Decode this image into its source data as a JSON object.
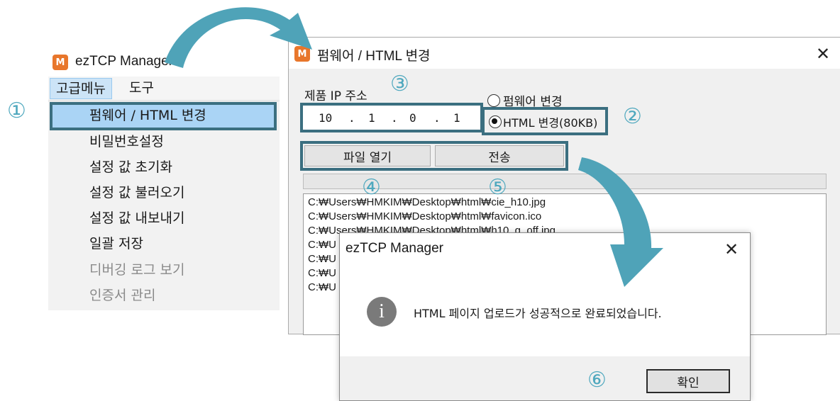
{
  "menu_window": {
    "title": "ezTCP Manager",
    "icon_letter": "M",
    "menubar": [
      "고급메뉴",
      "도구"
    ],
    "items": [
      {
        "label": "펌웨어 / HTML 변경",
        "enabled": true
      },
      {
        "label": "비밀번호설정",
        "enabled": true
      },
      {
        "label": "설정 값 초기화",
        "enabled": true
      },
      {
        "label": "설정 값 불러오기",
        "enabled": true
      },
      {
        "label": "설정 값 내보내기",
        "enabled": true
      },
      {
        "label": "일괄 저장",
        "enabled": true
      },
      {
        "label": "디버깅 로그 보기",
        "enabled": false
      },
      {
        "label": "인증서 관리",
        "enabled": false
      }
    ]
  },
  "firmware_window": {
    "title": "펌웨어 / HTML 변경",
    "close": "✕",
    "ip_label": "제품 IP 주소",
    "ip": [
      "10",
      "1",
      "0",
      "1"
    ],
    "ip_dot": ".",
    "radio_firmware": "펌웨어 변경",
    "radio_html": "HTML 변경(80KB)",
    "open_button": "파일 열기",
    "send_button": "전송",
    "files": [
      "C:₩Users₩HMKIM₩Desktop₩html₩cie_h10.jpg",
      "C:₩Users₩HMKIM₩Desktop₩html₩favicon.ico",
      "C:₩Users₩HMKIM₩Desktop₩html₩h10_g_off.jpg",
      "C:₩U",
      "C:₩U",
      "C:₩U",
      "C:₩U"
    ]
  },
  "dialog": {
    "title": "ezTCP Manager",
    "close": "✕",
    "icon_glyph": "i",
    "message": "HTML 페이지 업로드가 성공적으로 완료되었습니다.",
    "ok_button": "확인"
  },
  "step_numbers": [
    "①",
    "②",
    "③",
    "④",
    "⑤",
    "⑥"
  ],
  "colors": {
    "highlight_border": "#3b6f80",
    "arrow": "#4fa3b8",
    "step_number": "#4fa8be",
    "menu_selected": "#aad4f5",
    "app_icon": "#e8762b"
  }
}
